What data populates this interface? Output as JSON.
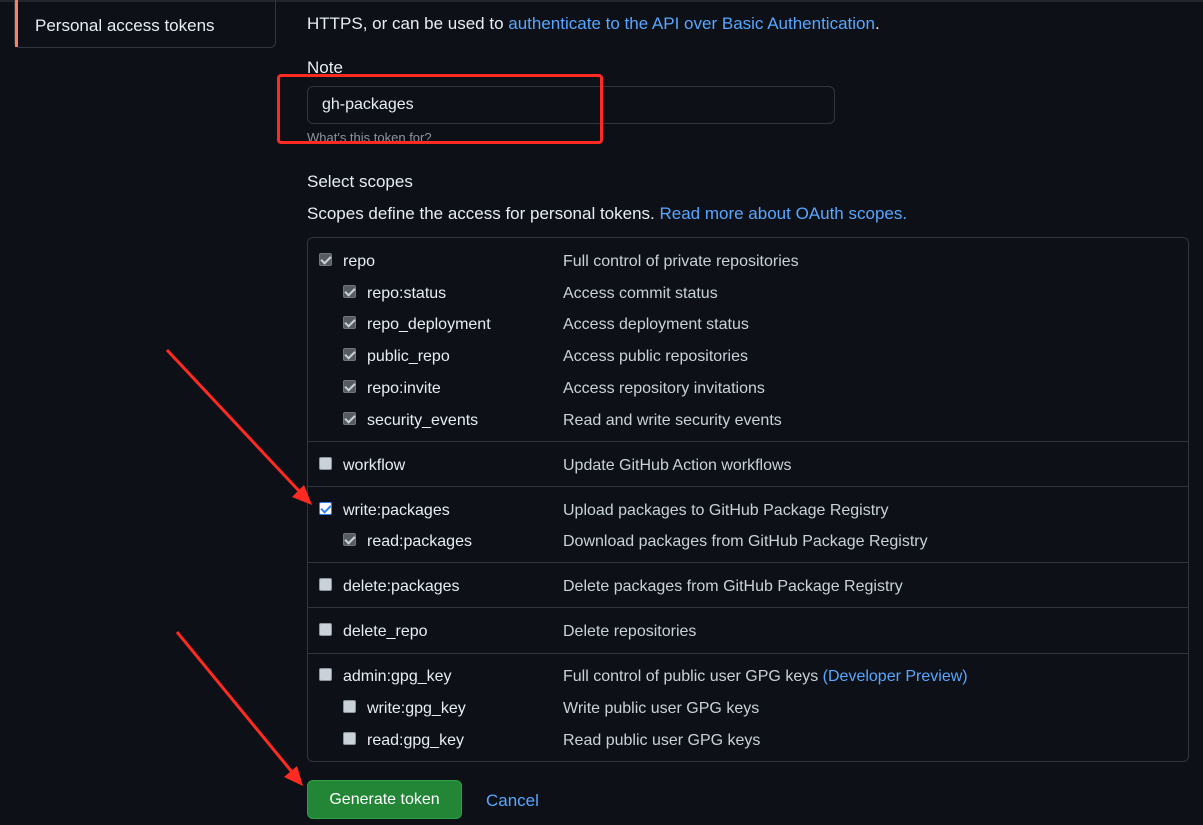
{
  "sidebar": {
    "active_item_label": "Personal access tokens"
  },
  "intro": {
    "text_before": "HTTPS, or can be used to ",
    "link_text": "authenticate to the API over Basic Authentication",
    "text_after": "."
  },
  "note": {
    "label": "Note",
    "value": "gh-packages",
    "help": "What's this token for?"
  },
  "scopes": {
    "title": "Select scopes",
    "description": "Scopes define the access for personal tokens. ",
    "description_link": "Read more about OAuth scopes.",
    "groups": [
      {
        "main": {
          "name": "repo",
          "description": "Full control of private repositories",
          "state": "disabled-checked"
        },
        "subs": [
          {
            "name": "repo:status",
            "description": "Access commit status",
            "state": "disabled-checked"
          },
          {
            "name": "repo_deployment",
            "description": "Access deployment status",
            "state": "disabled-checked"
          },
          {
            "name": "public_repo",
            "description": "Access public repositories",
            "state": "disabled-checked"
          },
          {
            "name": "repo:invite",
            "description": "Access repository invitations",
            "state": "disabled-checked"
          },
          {
            "name": "security_events",
            "description": "Read and write security events",
            "state": "disabled-checked"
          }
        ]
      },
      {
        "main": {
          "name": "workflow",
          "description": "Update GitHub Action workflows",
          "state": "unchecked"
        },
        "subs": []
      },
      {
        "main": {
          "name": "write:packages",
          "description": "Upload packages to GitHub Package Registry",
          "state": "checked"
        },
        "subs": [
          {
            "name": "read:packages",
            "description": "Download packages from GitHub Package Registry",
            "state": "disabled-checked"
          }
        ]
      },
      {
        "main": {
          "name": "delete:packages",
          "description": "Delete packages from GitHub Package Registry",
          "state": "unchecked"
        },
        "subs": []
      },
      {
        "main": {
          "name": "delete_repo",
          "description": "Delete repositories",
          "state": "unchecked"
        },
        "subs": []
      },
      {
        "main": {
          "name": "admin:gpg_key",
          "description": "Full control of public user GPG keys ",
          "description_link": "(Developer Preview)",
          "state": "unchecked"
        },
        "subs": [
          {
            "name": "write:gpg_key",
            "description": "Write public user GPG keys",
            "state": "unchecked"
          },
          {
            "name": "read:gpg_key",
            "description": "Read public user GPG keys",
            "state": "unchecked"
          }
        ]
      }
    ]
  },
  "actions": {
    "generate_label": "Generate token",
    "cancel_label": "Cancel"
  },
  "colors": {
    "background": "#0d1117",
    "link": "#58a6ff",
    "primary_button": "#238636",
    "annotation_red": "#ff2a22",
    "sidebar_accent": "#f78166"
  }
}
